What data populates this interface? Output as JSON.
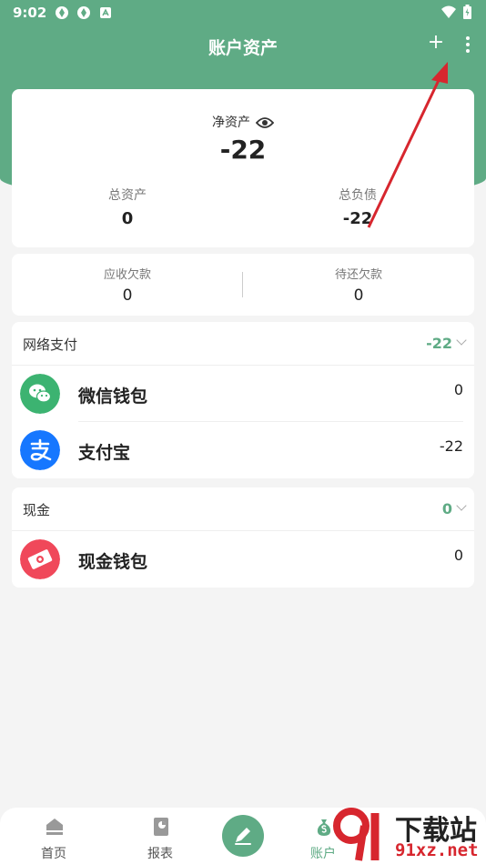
{
  "status_bar": {
    "time": "9:02"
  },
  "header": {
    "title": "账户资产",
    "add_icon": "plus-icon",
    "add_label": "+",
    "more_icon": "more-vert-icon"
  },
  "net_assets": {
    "label": "净资产",
    "value": "-22",
    "total_assets": {
      "label": "总资产",
      "value": "0"
    },
    "total_liabilities": {
      "label": "总负债",
      "value": "-22"
    }
  },
  "debts": {
    "receivable": {
      "label": "应收欠款",
      "value": "0"
    },
    "payable": {
      "label": "待还欠款",
      "value": "0"
    }
  },
  "groups": [
    {
      "title": "网络支付",
      "total": "-22",
      "accounts": [
        {
          "name": "微信钱包",
          "value": "0",
          "icon": "wechat-icon",
          "color": "#3cb371"
        },
        {
          "name": "支付宝",
          "value": "-22",
          "icon": "alipay-icon",
          "color": "#1677ff"
        }
      ]
    },
    {
      "title": "现金",
      "total": "0",
      "accounts": [
        {
          "name": "现金钱包",
          "value": "0",
          "icon": "cash-wallet-icon",
          "color": "#f0485a"
        }
      ]
    }
  ],
  "tabs": [
    {
      "label": "首页",
      "icon": "home-icon"
    },
    {
      "label": "报表",
      "icon": "report-icon"
    },
    {
      "label": "",
      "icon": "edit-icon"
    },
    {
      "label": "账户",
      "icon": "money-bag-icon"
    }
  ],
  "watermark": {
    "main": "下载站",
    "sub": "91xz.net"
  },
  "colors": {
    "brand": "#5fab85",
    "annotation_arrow": "#d7262e"
  }
}
